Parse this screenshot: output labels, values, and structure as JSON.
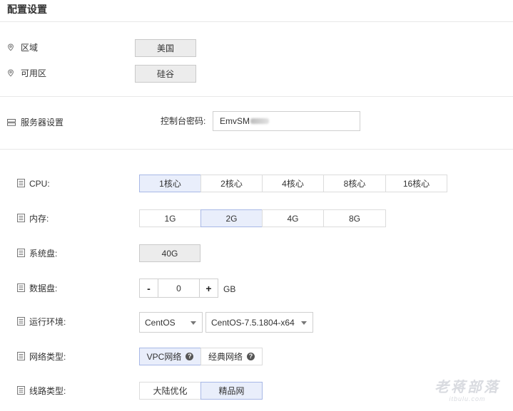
{
  "page": {
    "title": "配置设置"
  },
  "region": {
    "label": "区域",
    "value": "美国",
    "zone_label": "可用区",
    "zone_value": "硅谷"
  },
  "server": {
    "label": "服务器设置",
    "password_label": "控制台密码:",
    "password_value": "EmvSM"
  },
  "cpu": {
    "label": "CPU:",
    "options": [
      "1核心",
      "2核心",
      "4核心",
      "8核心",
      "16核心"
    ],
    "selected": "1核心"
  },
  "memory": {
    "label": "内存:",
    "options": [
      "1G",
      "2G",
      "4G",
      "8G"
    ],
    "selected": "2G"
  },
  "system_disk": {
    "label": "系统盘:",
    "value": "40G"
  },
  "data_disk": {
    "label": "数据盘:",
    "minus": "-",
    "value": "0",
    "plus": "+",
    "unit": "GB"
  },
  "runtime": {
    "label": "运行环境:",
    "os": "CentOS",
    "version": "CentOS-7.5.1804-x64"
  },
  "network": {
    "label": "网络类型:",
    "options": [
      "VPC网络",
      "经典网络"
    ],
    "selected": "VPC网络",
    "help_glyph": "?"
  },
  "line": {
    "label": "线路类型:",
    "options": [
      "大陆优化",
      "精品网"
    ],
    "selected": "精品网"
  },
  "watermark": {
    "main": "老蒋部落",
    "sub": "itbulu.com"
  },
  "colors": {
    "selected_bg": "#e9eefb",
    "selected_border": "#a8b8e6",
    "disabled_bg": "#ececec"
  }
}
